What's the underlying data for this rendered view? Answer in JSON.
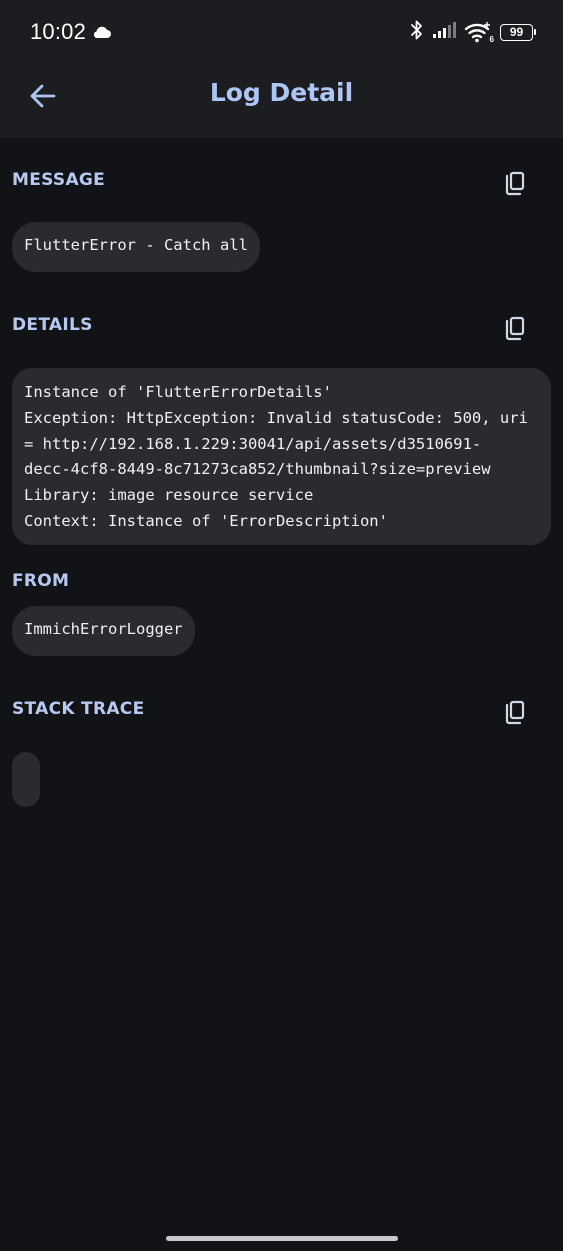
{
  "status_bar": {
    "time": "10:02",
    "battery_level": "99",
    "wifi_badge": "6",
    "icons": [
      "cloud-icon",
      "bluetooth-icon",
      "signal-icon",
      "wifi-icon",
      "battery-icon"
    ]
  },
  "app_bar": {
    "title": "Log Detail",
    "back_icon": "arrow-back-icon"
  },
  "sections": {
    "message": {
      "title": "MESSAGE",
      "value": "FlutterError - Catch all",
      "copy_icon": "copy-icon"
    },
    "details": {
      "title": "DETAILS",
      "lines": [
        "Instance of 'FlutterErrorDetails'",
        "Exception: HttpException: Invalid statusCode: 500, uri",
        "= http://192.168.1.229:30041/api/assets/d3510691-",
        "decc-4cf8-8449-8c71273ca852/thumbnail?size=preview",
        "Library: image resource service",
        "Context: Instance of 'ErrorDescription'"
      ],
      "copy_icon": "copy-icon"
    },
    "from": {
      "title": "FROM",
      "value": "ImmichErrorLogger"
    },
    "stack_trace": {
      "title": "STACK TRACE",
      "value": "",
      "copy_icon": "copy-icon"
    }
  },
  "colors": {
    "background": "#121316",
    "app_bar": "#1c1d21",
    "accent_title": "#aec6f6",
    "section_title": "#b7c9f0",
    "chip": "#2a2b30"
  }
}
